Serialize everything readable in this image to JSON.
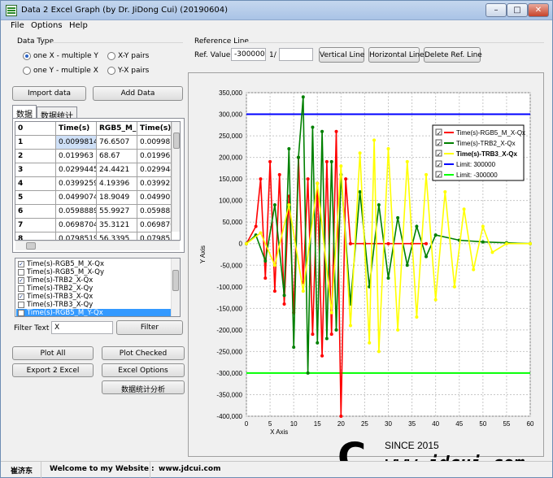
{
  "window": {
    "title": "Data 2 Excel Graph (by Dr. JiDong Cui) (20190604)",
    "minimize": "–",
    "maximize": "□",
    "close": "✕"
  },
  "menu": [
    "File",
    "Options",
    "Help"
  ],
  "data_type": {
    "label": "Data Type",
    "options": [
      {
        "label": "one X  - multiple Y",
        "selected": true
      },
      {
        "label": "X-Y pairs",
        "selected": false
      },
      {
        "label": "one Y  - multiple X",
        "selected": false
      },
      {
        "label": "Y-X pairs",
        "selected": false
      }
    ]
  },
  "reference": {
    "label": "Reference Line",
    "ref_value_label": "Ref. Value",
    "ref_value": "-300000",
    "fraction_label": "1/",
    "fraction_value": "",
    "vertical_btn": "Vertical Line",
    "horizontal_btn": "Horizontal Line",
    "delete_btn": "Delete Ref. Line"
  },
  "buttons": {
    "import_data": "Import data",
    "add_data": "Add Data",
    "filter": "Filter",
    "plot_all": "Plot All",
    "plot_checked": "Plot Checked",
    "export_excel": "Export 2 Excel",
    "excel_options": "Excel Options",
    "stats_analysis": "数据统计分析"
  },
  "tabs": [
    "数据",
    "数据统计"
  ],
  "grid": {
    "headers": [
      "0",
      "Time(s)",
      "RGB5_M_",
      "Time(s)"
    ],
    "rows": [
      [
        "1",
        "0.00998149",
        "76.6507",
        "0.00998149"
      ],
      [
        "2",
        "0.019963",
        "68.67",
        "0.019963"
      ],
      [
        "3",
        "0.0299445",
        "24.4421",
        "0.0299445"
      ],
      [
        "4",
        "0.0399259",
        "4.19396",
        "0.0399259"
      ],
      [
        "5",
        "0.0499074",
        "18.9049",
        "0.0499074"
      ],
      [
        "6",
        "0.0598889",
        "55.9927",
        "0.0598889"
      ],
      [
        "7",
        "0.0698704",
        "35.3121",
        "0.0698704"
      ],
      [
        "8",
        "0.0798519",
        "56.3395",
        "0.0798519"
      ]
    ]
  },
  "series_list": [
    {
      "label": "Time(s)-RGB5_M_X-Qx",
      "checked": true
    },
    {
      "label": "Time(s)-RGB5_M_X-Qy",
      "checked": false
    },
    {
      "label": "Time(s)-TRB2_X-Qx",
      "checked": true
    },
    {
      "label": "Time(s)-TRB2_X-Qy",
      "checked": false
    },
    {
      "label": "Time(s)-TRB3_X-Qx",
      "checked": true
    },
    {
      "label": "Time(s)-TRB3_X-Qy",
      "checked": false
    },
    {
      "label": "Time(s)-RGB5_M_Y-Qx",
      "checked": false
    }
  ],
  "filter": {
    "label": "Filter Text",
    "value": "X"
  },
  "chart_data": {
    "type": "line",
    "xlabel": "X Axis",
    "ylabel": "Y Axis",
    "xlim": [
      0,
      60
    ],
    "ylim": [
      -400000,
      350000
    ],
    "xticks": [
      0,
      5,
      10,
      15,
      20,
      25,
      30,
      35,
      40,
      45,
      50,
      55,
      60
    ],
    "yticks": [
      350000,
      300000,
      250000,
      200000,
      150000,
      100000,
      50000,
      0,
      -50000,
      -100000,
      -150000,
      -200000,
      -250000,
      -300000,
      -350000,
      -400000
    ],
    "ytick_labels": [
      "350,000",
      "300,000",
      "250,000",
      "200,000",
      "150,000",
      "100,000",
      "50,000",
      "0",
      "-50,000",
      "-100,000",
      "-150,000",
      "-200,000",
      "-250,000",
      "-300,000",
      "-350,000",
      "-400,000"
    ],
    "grid": true,
    "legend_position": "top-right",
    "series": [
      {
        "name": "Time(s)-RGB5_M_X-Qx",
        "color": "#ff0000",
        "x": [
          0,
          2,
          3,
          4,
          5,
          6,
          7,
          8,
          9,
          10,
          11,
          12,
          13,
          14,
          15,
          16,
          17,
          18,
          19,
          20,
          21,
          22,
          25,
          30,
          35,
          38
        ],
        "y": [
          0,
          40000,
          150000,
          -80000,
          190000,
          -110000,
          160000,
          -140000,
          110000,
          -160000,
          200000,
          -90000,
          150000,
          -210000,
          140000,
          -260000,
          190000,
          -210000,
          260000,
          -400000,
          150000,
          0,
          0,
          0,
          0,
          0
        ]
      },
      {
        "name": "Time(s)-TRB2_X-Qx",
        "color": "#008000",
        "x": [
          0,
          2,
          4,
          6,
          8,
          9,
          10,
          11,
          12,
          13,
          14,
          15,
          16,
          17,
          18,
          19,
          20,
          22,
          24,
          26,
          28,
          30,
          32,
          34,
          36,
          38,
          40,
          45,
          50,
          55,
          60
        ],
        "y": [
          0,
          20000,
          -40000,
          90000,
          -120000,
          220000,
          -240000,
          200000,
          340000,
          -300000,
          270000,
          -230000,
          260000,
          -220000,
          190000,
          -200000,
          160000,
          -140000,
          120000,
          -100000,
          90000,
          -80000,
          60000,
          -50000,
          40000,
          -30000,
          20000,
          8000,
          4000,
          2000,
          0
        ]
      },
      {
        "name": "Time(s)-TRB3_X-Qx",
        "color": "#ffff00",
        "x": [
          0,
          3,
          6,
          9,
          12,
          15,
          18,
          20,
          22,
          24,
          26,
          27,
          28,
          30,
          32,
          34,
          36,
          38,
          40,
          42,
          44,
          46,
          48,
          50,
          52,
          55,
          60
        ],
        "y": [
          0,
          25000,
          -50000,
          90000,
          -110000,
          140000,
          -160000,
          180000,
          -190000,
          210000,
          -230000,
          240000,
          -250000,
          220000,
          -200000,
          190000,
          -170000,
          160000,
          -130000,
          120000,
          -100000,
          80000,
          -60000,
          40000,
          -20000,
          0,
          0
        ]
      }
    ],
    "reference_lines": [
      {
        "name": "Limit: 300000",
        "value": 300000,
        "color": "#0000ff"
      },
      {
        "name": "Limit: -300000",
        "value": -300000,
        "color": "#00ff00"
      }
    ]
  },
  "status": {
    "author": "崔济东",
    "welcome": "Welcome to my Website :",
    "site": "www.jdcui.com"
  },
  "logo": {
    "since": "SINCE 2015",
    "url": "www.jdcui.com",
    "mark": "C"
  }
}
